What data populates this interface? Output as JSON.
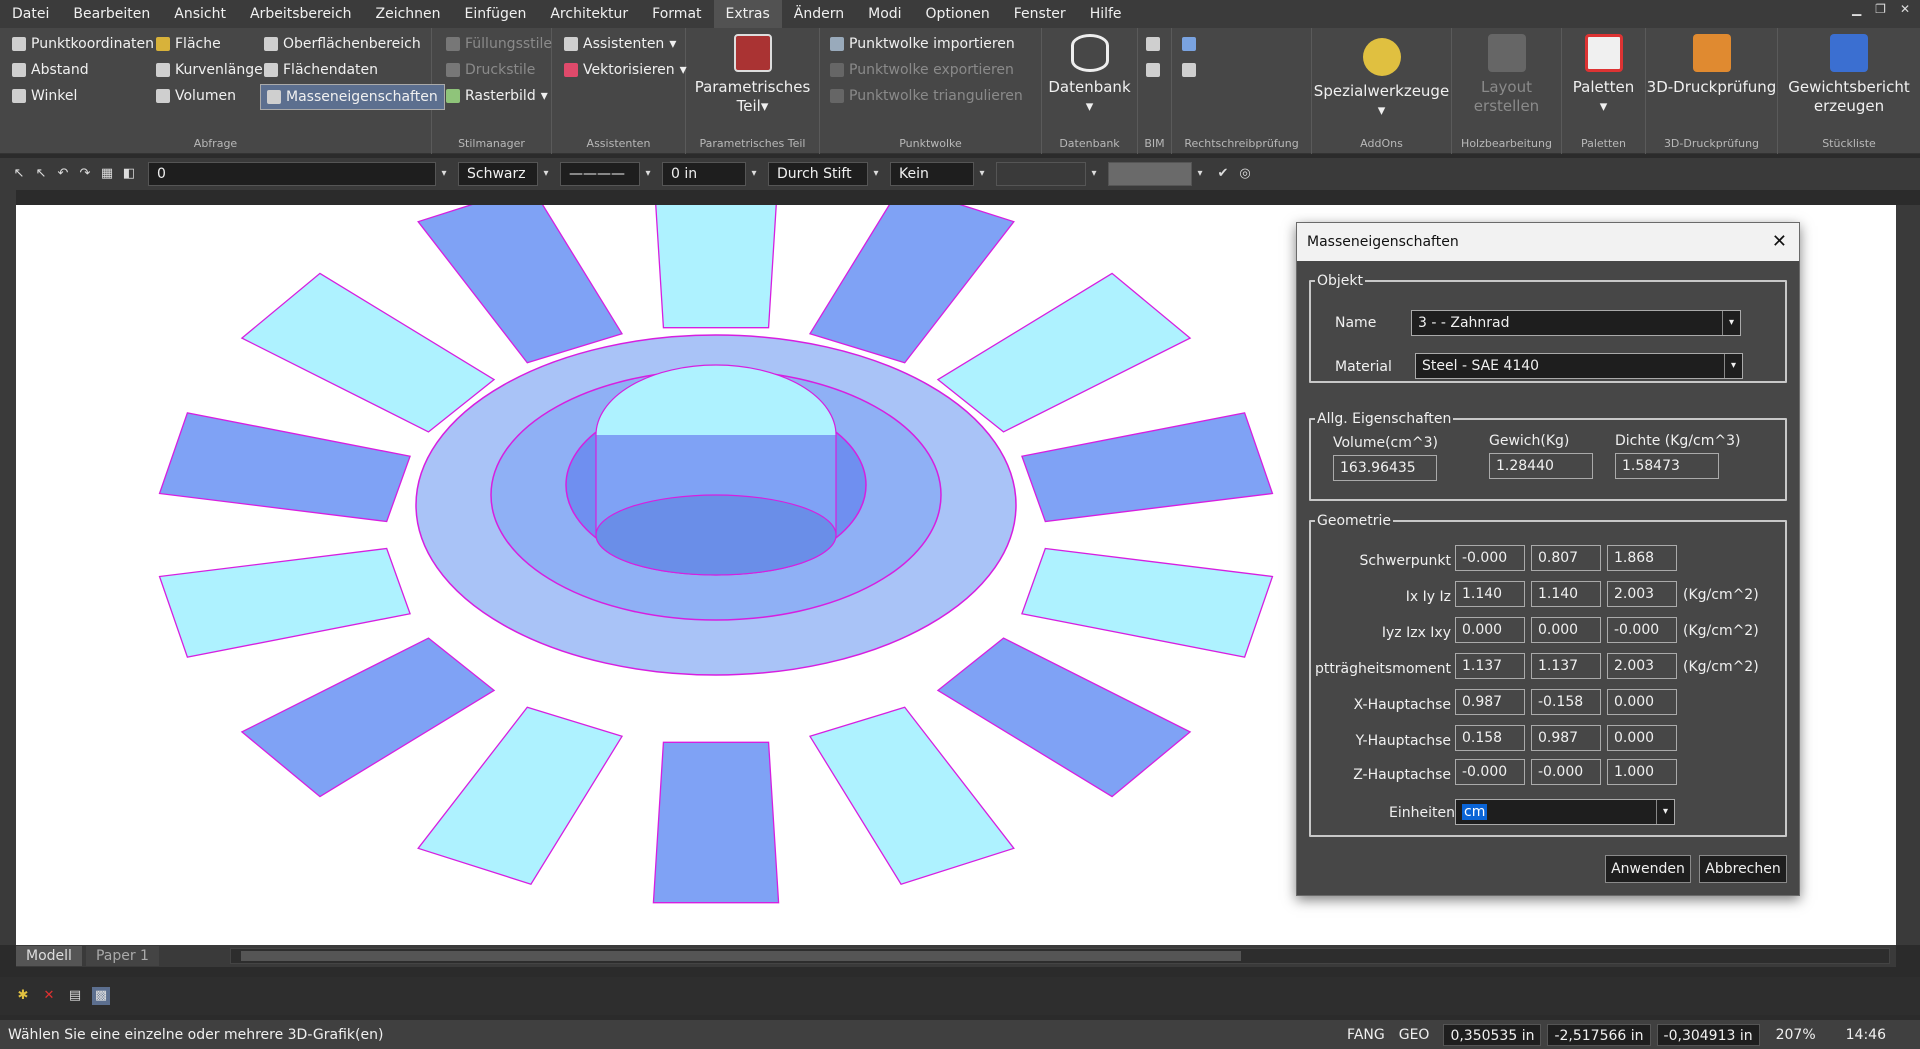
{
  "menu": [
    "Datei",
    "Bearbeiten",
    "Ansicht",
    "Arbeitsbereich",
    "Zeichnen",
    "Einfügen",
    "Architektur",
    "Format",
    "Extras",
    "Ändern",
    "Modi",
    "Optionen",
    "Fenster",
    "Hilfe"
  ],
  "menu_active": "Extras",
  "ribbon": {
    "abfrage": {
      "label": "Abfrage",
      "items": [
        "Punktkoordinaten",
        "Abstand",
        "Winkel",
        "Fläche",
        "Kurvenlänge",
        "Volumen",
        "Oberflächenbereich",
        "Flächendaten",
        "Masseneigenschaften"
      ]
    },
    "stilmanager": {
      "label": "Stilmanager",
      "items": [
        "Füllungsstile",
        "Druckstile",
        "Rasterbild"
      ]
    },
    "assistenten": {
      "label": "Assistenten",
      "items": [
        "Assistenten",
        "Vektorisieren"
      ]
    },
    "parametrisch": {
      "label": "Parametrisches Teil",
      "line1": "Parametrisches",
      "line2": "Teil"
    },
    "punktwolke": {
      "label": "Punktwolke",
      "items": [
        "Punktwolke importieren",
        "Punktwolke exportieren",
        "Punktwolke triangulieren"
      ]
    },
    "datenbank": {
      "label": "Datenbank",
      "button": "Datenbank"
    },
    "bim": {
      "label": "BIM"
    },
    "rechtschreib": {
      "label": "Rechtschreibprüfung"
    },
    "addons": {
      "label": "AddOns",
      "button": "Spezialwerkzeuge"
    },
    "holz": {
      "label": "Holzbearbeitung",
      "line1": "Layout",
      "line2": "erstellen"
    },
    "paletten": {
      "label": "Paletten",
      "button": "Paletten"
    },
    "druck3d": {
      "label": "3D-Druckprüfung",
      "button": "3D-Druckprüfung"
    },
    "stueck": {
      "label": "Stückliste",
      "line1": "Gewichtsbericht",
      "line2": "erzeugen"
    }
  },
  "toolbar": {
    "layer": "0",
    "color": "Schwarz",
    "width": "0 in",
    "plot": "Durch Stift",
    "fill": "Kein"
  },
  "tabs": {
    "model": "Modell",
    "paper": "Paper 1"
  },
  "status": {
    "message": "Wählen Sie eine einzelne oder mehrere 3D-Grafik(en)",
    "fang": "FANG",
    "geo": "GEO",
    "x": "0,350535 in",
    "y": "-2,517566 in",
    "z": "-0,304913 in",
    "zoom": "207%",
    "time": "14:46"
  },
  "dialog": {
    "title": "Masseneigenschaften",
    "objekt": {
      "legend": "Objekt",
      "name_label": "Name",
      "name_value": "3 -  - Zahnrad",
      "material_label": "Material",
      "material_value": "Steel - SAE 4140"
    },
    "allg": {
      "legend": "Allg. Eigenschaften",
      "vol_label": "Volume(cm^3)",
      "vol": "163.96435",
      "gew_label": "Gewich(Kg)",
      "gew": "1.28440",
      "dichte_label": "Dichte  (Kg/cm^3)",
      "dichte": "1.58473"
    },
    "geo": {
      "legend": "Geometrie",
      "rows": [
        {
          "label": "Schwerpunkt",
          "v": [
            "-0.000",
            "0.807",
            "1.868"
          ],
          "unit": ""
        },
        {
          "label": "Ix Iy Iz",
          "v": [
            "1.140",
            "1.140",
            "2.003"
          ],
          "unit": "(Kg/cm^2)"
        },
        {
          "label": "Iyz Izx Ixy",
          "v": [
            "0.000",
            "0.000",
            "-0.000"
          ],
          "unit": "(Kg/cm^2)"
        },
        {
          "label": "ptträgheitsmoment",
          "v": [
            "1.137",
            "1.137",
            "2.003"
          ],
          "unit": "(Kg/cm^2)"
        },
        {
          "label": "X-Hauptachse",
          "v": [
            "0.987",
            "-0.158",
            "0.000"
          ],
          "unit": ""
        },
        {
          "label": "Y-Hauptachse",
          "v": [
            "0.158",
            "0.987",
            "0.000"
          ],
          "unit": ""
        },
        {
          "label": "Z-Hauptachse",
          "v": [
            "-0.000",
            "-0.000",
            "1.000"
          ],
          "unit": ""
        }
      ],
      "einheiten_label": "Einheiten",
      "einheiten": "cm"
    },
    "apply": "Anwenden",
    "cancel": "Abbrechen"
  },
  "colors": {
    "gear": "#7fa2f5",
    "gear_light": "#aef2ff",
    "wire": "#d61fe0",
    "accent": "#0a64d6"
  }
}
